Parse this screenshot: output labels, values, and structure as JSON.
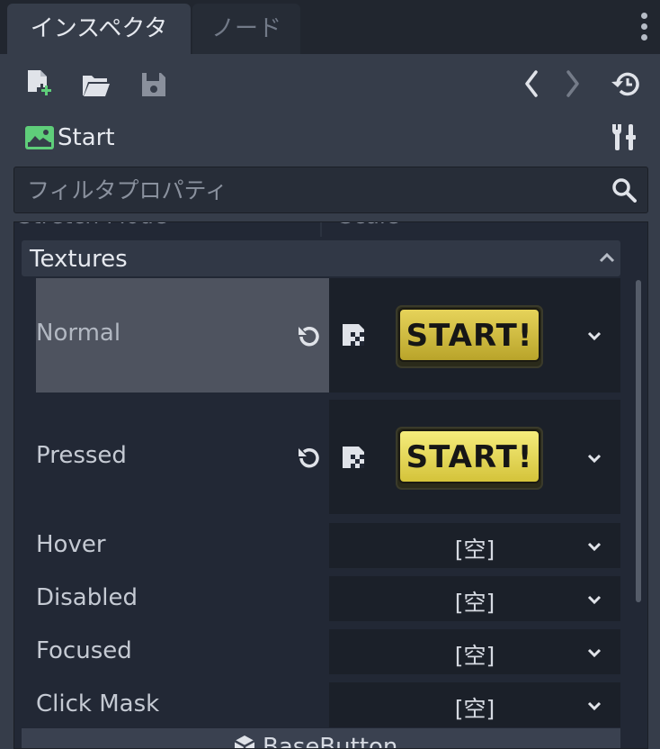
{
  "tabs": [
    {
      "label": "インスペクタ",
      "active": true
    },
    {
      "label": "ノード",
      "active": false
    }
  ],
  "toolbar": {
    "icons": [
      "new-resource-icon",
      "open-folder-icon",
      "save-icon",
      "back-icon",
      "forward-icon",
      "history-icon"
    ]
  },
  "object": {
    "name": "Start",
    "icon": "texture-button-icon",
    "tools_icon": "tools-icon"
  },
  "filter": {
    "placeholder": "フィルタプロパティ"
  },
  "partial_row": {
    "label": "Stretch Mode",
    "value": "Scale"
  },
  "section": {
    "title": "Textures"
  },
  "properties": [
    {
      "label": "Normal",
      "value_image_text": "START!",
      "has_revert": true,
      "highlighted": true
    },
    {
      "label": "Pressed",
      "value_image_text": "START!",
      "has_revert": true
    },
    {
      "label": "Hover",
      "value": "[空]"
    },
    {
      "label": "Disabled",
      "value": "[空]"
    },
    {
      "label": "Focused",
      "value": "[空]"
    },
    {
      "label": "Click Mask",
      "value": "[空]"
    }
  ],
  "inherited": {
    "label": "BaseButton"
  },
  "colors": {
    "accent_green": "#5fce7a",
    "background": "#363d4a",
    "panel": "#222835"
  }
}
